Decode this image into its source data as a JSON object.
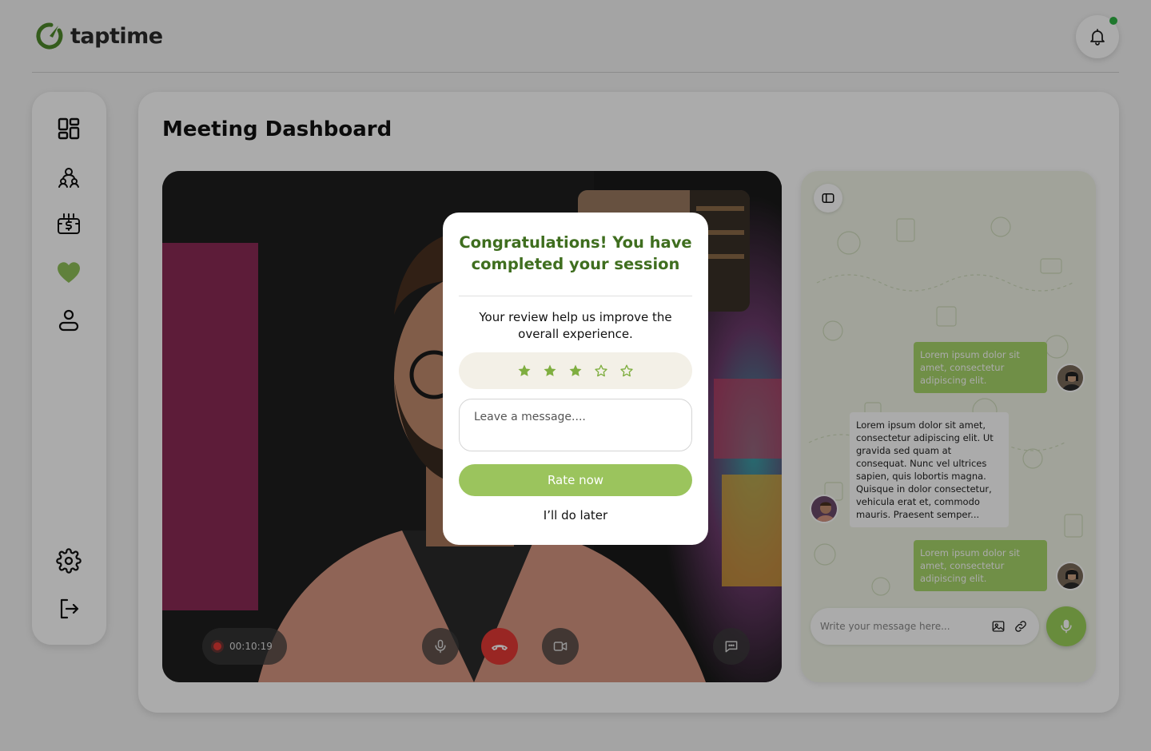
{
  "app": {
    "name": "taptime",
    "accent": "#9bc45d",
    "brand_dark": "#3f6e1f"
  },
  "header": {
    "notification_icon": "bell-icon",
    "notification_status": "online"
  },
  "sidebar": {
    "items": [
      {
        "icon": "dashboard-icon"
      },
      {
        "icon": "people-icon"
      },
      {
        "icon": "payment-icon"
      },
      {
        "icon": "heart-icon",
        "active": true
      },
      {
        "icon": "profile-icon"
      }
    ],
    "bottom": [
      {
        "icon": "settings-icon"
      },
      {
        "icon": "logout-icon"
      }
    ]
  },
  "main": {
    "title": "Meeting Dashboard"
  },
  "call": {
    "timer": "00:10:19",
    "controls": [
      "mic-icon",
      "end-call-icon",
      "camera-icon",
      "chat-icon"
    ]
  },
  "chat": {
    "messages": [
      {
        "direction": "out",
        "text": "Lorem ipsum dolor sit amet, consectetur adipiscing elit."
      },
      {
        "direction": "in",
        "text": "Lorem ipsum dolor sit amet, consectetur adipiscing elit. Ut gravida sed quam at consequat. Nunc vel ultrices sapien, quis lobortis magna. Quisque in dolor consectetur, vehicula erat et, commodo mauris. Praesent semper..."
      },
      {
        "direction": "out",
        "text": "Lorem ipsum dolor sit amet, consectetur adipiscing elit."
      }
    ],
    "input_placeholder": "Write your message here..."
  },
  "modal": {
    "title": "Congratulations! You have completed your session",
    "subtitle": "Your review help us improve the overall experience.",
    "rating": 3,
    "rating_max": 5,
    "message_placeholder": "Leave a message....",
    "rate_label": "Rate now",
    "later_label": "I’ll do later"
  }
}
